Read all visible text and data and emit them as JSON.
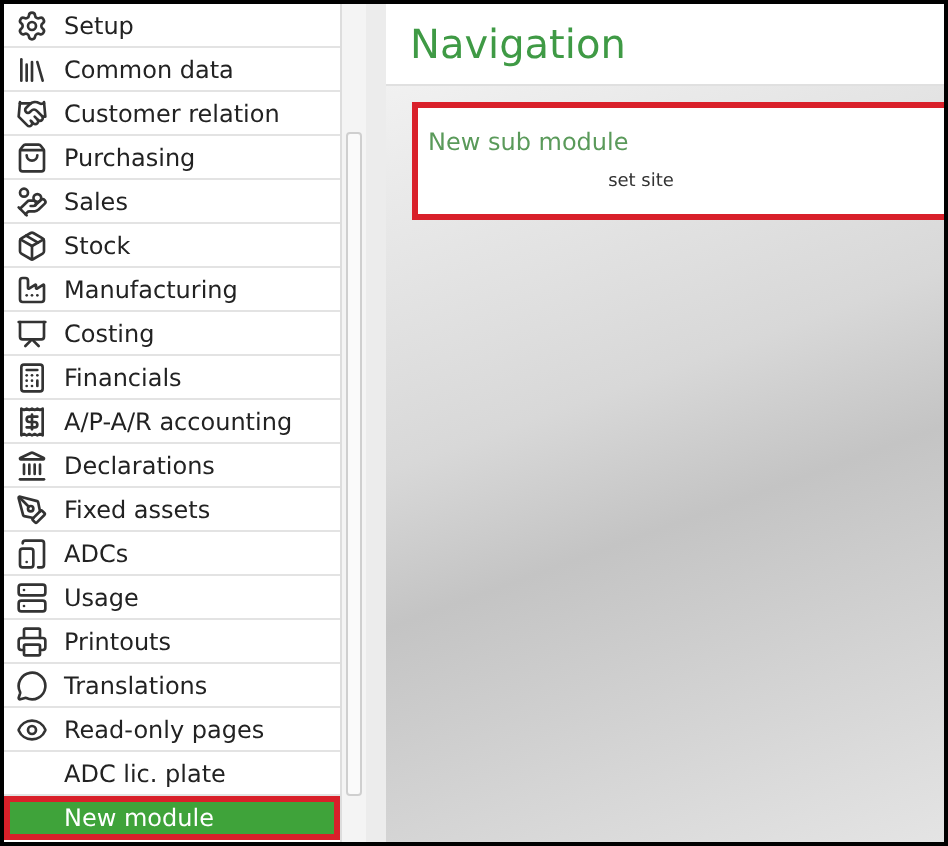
{
  "sidebar": {
    "items": [
      {
        "label": "Setup",
        "selected": false,
        "highlighted": false
      },
      {
        "label": "Common data",
        "selected": false,
        "highlighted": false
      },
      {
        "label": "Customer relation",
        "selected": false,
        "highlighted": false
      },
      {
        "label": "Purchasing",
        "selected": false,
        "highlighted": false
      },
      {
        "label": "Sales",
        "selected": false,
        "highlighted": false
      },
      {
        "label": "Stock",
        "selected": false,
        "highlighted": false
      },
      {
        "label": "Manufacturing",
        "selected": false,
        "highlighted": false
      },
      {
        "label": "Costing",
        "selected": false,
        "highlighted": false
      },
      {
        "label": "Financials",
        "selected": false,
        "highlighted": false
      },
      {
        "label": "A/P-A/R accounting",
        "selected": false,
        "highlighted": false
      },
      {
        "label": "Declarations",
        "selected": false,
        "highlighted": false
      },
      {
        "label": "Fixed assets",
        "selected": false,
        "highlighted": false
      },
      {
        "label": "ADCs",
        "selected": false,
        "highlighted": false
      },
      {
        "label": "Usage",
        "selected": false,
        "highlighted": false
      },
      {
        "label": "Printouts",
        "selected": false,
        "highlighted": false
      },
      {
        "label": "Translations",
        "selected": false,
        "highlighted": false
      },
      {
        "label": "Read-only pages",
        "selected": false,
        "highlighted": false
      },
      {
        "label": "ADC lic. plate",
        "selected": false,
        "highlighted": false
      },
      {
        "label": "New module",
        "selected": true,
        "highlighted": true
      }
    ]
  },
  "main": {
    "title": "Navigation",
    "card": {
      "title": "New sub module",
      "link": "set site",
      "highlighted": true
    }
  }
}
